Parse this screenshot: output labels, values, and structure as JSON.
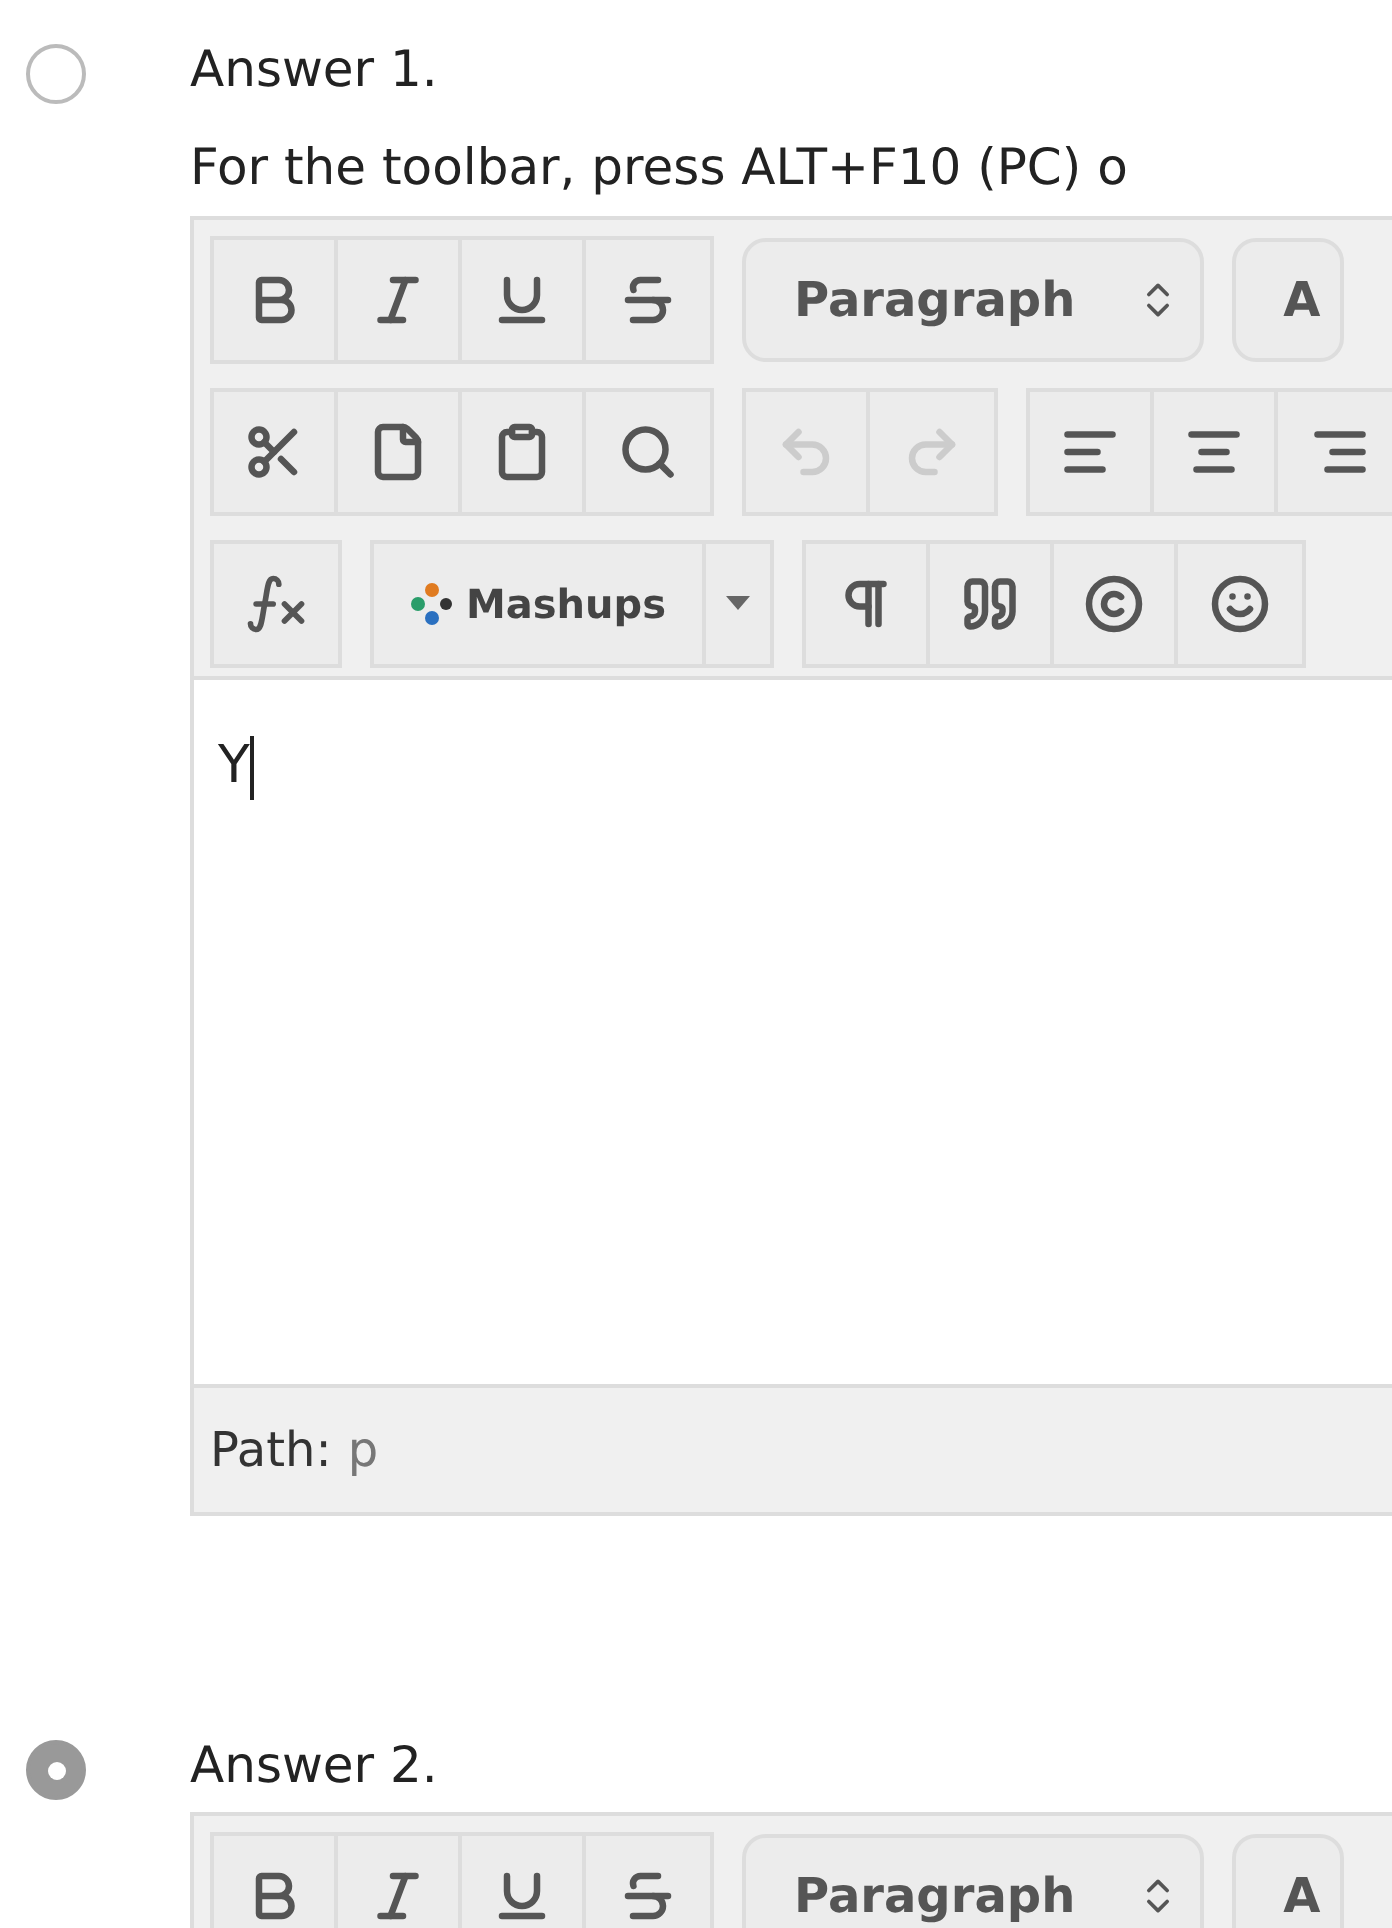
{
  "answers": [
    {
      "label": "Answer 1.",
      "selected": false,
      "instruction": "For the toolbar, press ALT+F10 (PC) o",
      "editor": {
        "format_select": "Paragraph",
        "font_select": "A",
        "undo": {
          "disabled": true
        },
        "redo": {
          "disabled": true
        },
        "mashups": "Mashups",
        "body": "Y",
        "path_label": "Path:",
        "path_value": "p"
      }
    },
    {
      "label": "Answer 2.",
      "selected": true,
      "editor": {
        "format_select": "Paragraph",
        "font_select": "A"
      }
    }
  ]
}
